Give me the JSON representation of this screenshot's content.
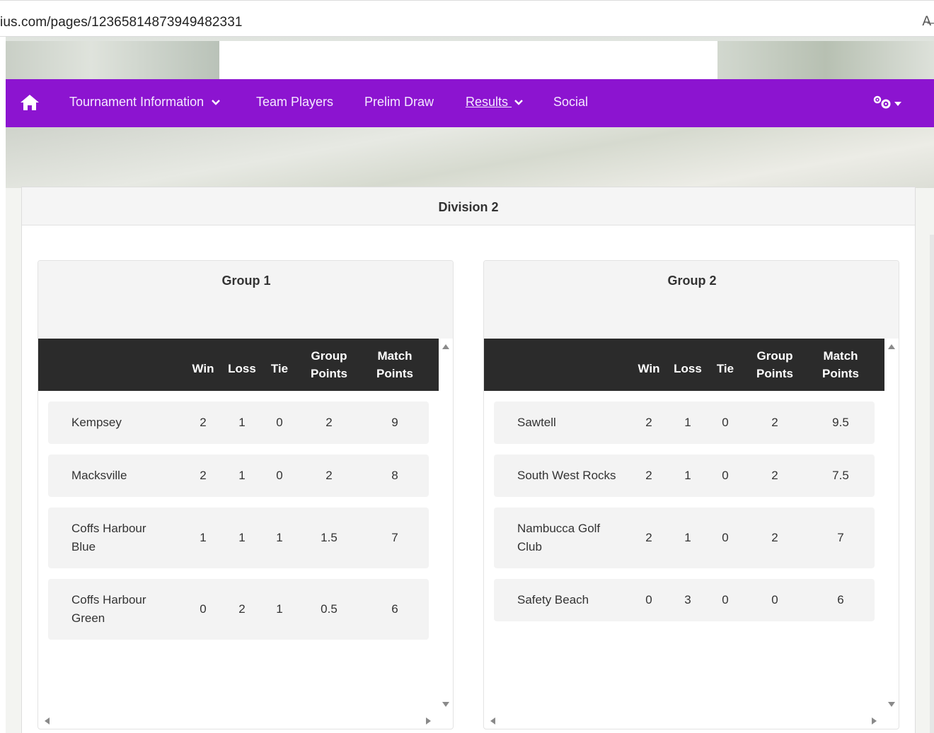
{
  "browser": {
    "url": "ius.com/pages/12365814873949482331",
    "reader_icon": "A̶"
  },
  "nav": {
    "home_icon": "home-icon",
    "items": [
      {
        "label": "Tournament Information",
        "has_dropdown": true,
        "active": false
      },
      {
        "label": "Team Players",
        "has_dropdown": false,
        "active": false
      },
      {
        "label": "Prelim Draw",
        "has_dropdown": false,
        "active": false
      },
      {
        "label": "Results",
        "has_dropdown": true,
        "active": true
      },
      {
        "label": "Social",
        "has_dropdown": false,
        "active": false
      }
    ],
    "settings_icon": "gears-icon",
    "background_color": "#8c14d0"
  },
  "division": {
    "title": "Division 2"
  },
  "columns": {
    "win": "Win",
    "loss": "Loss",
    "tie": "Tie",
    "group_points_1": "Group",
    "group_points_2": "Points",
    "match_points_1": "Match",
    "match_points_2": "Points"
  },
  "groups": [
    {
      "title": "Group 1",
      "rows": [
        {
          "team_1": "Kempsey",
          "team_2": "",
          "win": "2",
          "loss": "1",
          "tie": "0",
          "group_points": "2",
          "match_points": "9"
        },
        {
          "team_1": "Macksville",
          "team_2": "",
          "win": "2",
          "loss": "1",
          "tie": "0",
          "group_points": "2",
          "match_points": "8"
        },
        {
          "team_1": "Coffs Harbour",
          "team_2": "Blue",
          "win": "1",
          "loss": "1",
          "tie": "1",
          "group_points": "1.5",
          "match_points": "7"
        },
        {
          "team_1": "Coffs Harbour",
          "team_2": "Green",
          "win": "0",
          "loss": "2",
          "tie": "1",
          "group_points": "0.5",
          "match_points": "6"
        }
      ]
    },
    {
      "title": "Group 2",
      "rows": [
        {
          "team_1": "Sawtell",
          "team_2": "",
          "win": "2",
          "loss": "1",
          "tie": "0",
          "group_points": "2",
          "match_points": "9.5"
        },
        {
          "team_1": "South West Rocks",
          "team_2": "",
          "win": "2",
          "loss": "1",
          "tie": "0",
          "group_points": "2",
          "match_points": "7.5"
        },
        {
          "team_1": "Nambucca Golf",
          "team_2": "Club",
          "win": "2",
          "loss": "1",
          "tie": "0",
          "group_points": "2",
          "match_points": "7"
        },
        {
          "team_1": "Safety Beach",
          "team_2": "",
          "win": "0",
          "loss": "3",
          "tie": "0",
          "group_points": "0",
          "match_points": "6"
        }
      ]
    }
  ]
}
